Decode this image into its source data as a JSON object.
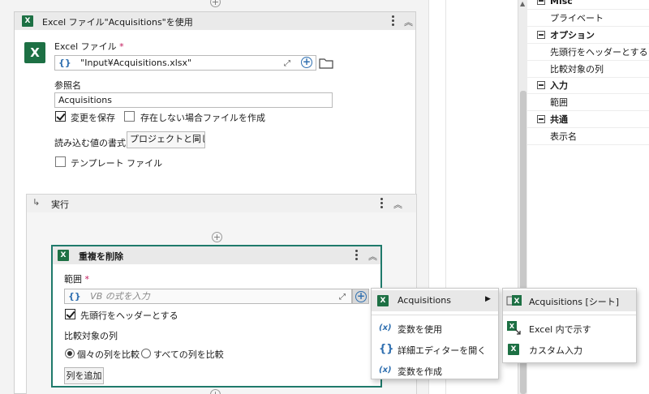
{
  "excel_scope": {
    "title": "Excel ファイル\"Acquisitions\"を使用",
    "file_label": "Excel ファイル",
    "required_mark": "*",
    "file_value": "\"Input¥Acquisitions.xlsx\"",
    "ref_name_label": "参照名",
    "ref_name_value": "Acquisitions",
    "save_changes_label": "変更を保存",
    "save_changes_checked": true,
    "create_if_missing_label": "存在しない場合ファイルを作成",
    "create_if_missing_checked": false,
    "read_format_label": "読み込む値の書式",
    "read_format_value": "プロジェクトと同じ",
    "template_file_label": "テンプレート ファイル",
    "template_file_checked": false
  },
  "run_block": {
    "title": "実行"
  },
  "remove_duplicates": {
    "title": "重複を削除",
    "range_label": "範囲",
    "required_mark": "*",
    "range_placeholder": "VB の式を入力",
    "header_row_label": "先頭行をヘッダーとする",
    "header_row_checked": true,
    "compare_columns_label": "比較対象の列",
    "radio_each_label": "個々の列を比較",
    "radio_all_label": "すべての列を比較",
    "radio_selected": "each",
    "add_column_button": "列を追加"
  },
  "context_menu": {
    "items": [
      {
        "label": "Acquisitions",
        "icon": "excel-icon",
        "has_submenu": true,
        "highlighted": true
      },
      {
        "label": "変数を使用",
        "icon": "variable-icon"
      },
      {
        "label": "詳細エディターを開く",
        "icon": "braces-icon"
      },
      {
        "label": "変数を作成",
        "icon": "variable-icon"
      }
    ]
  },
  "submenu": {
    "items": [
      {
        "label": "Acquisitions [シート]",
        "icon": "sheet-icon",
        "highlighted": true
      },
      {
        "label": "Excel 内で示す",
        "icon": "excel-locate-icon"
      },
      {
        "label": "カスタム入力",
        "icon": "excel-icon"
      }
    ]
  },
  "properties": {
    "rows": [
      {
        "type": "category",
        "label": "Misc"
      },
      {
        "type": "item",
        "label": "プライベート"
      },
      {
        "type": "category",
        "label": "オプション"
      },
      {
        "type": "item",
        "label": "先頭行をヘッダーとする"
      },
      {
        "type": "item",
        "label": "比較対象の列"
      },
      {
        "type": "category",
        "label": "入力"
      },
      {
        "type": "item",
        "label": "範囲"
      },
      {
        "type": "category",
        "label": "共通"
      },
      {
        "type": "item",
        "label": "表示名"
      }
    ]
  },
  "colors": {
    "selected_border": "#1f7a6b",
    "excel_green": "#1d7044",
    "accent_blue": "#2f6fb0"
  }
}
